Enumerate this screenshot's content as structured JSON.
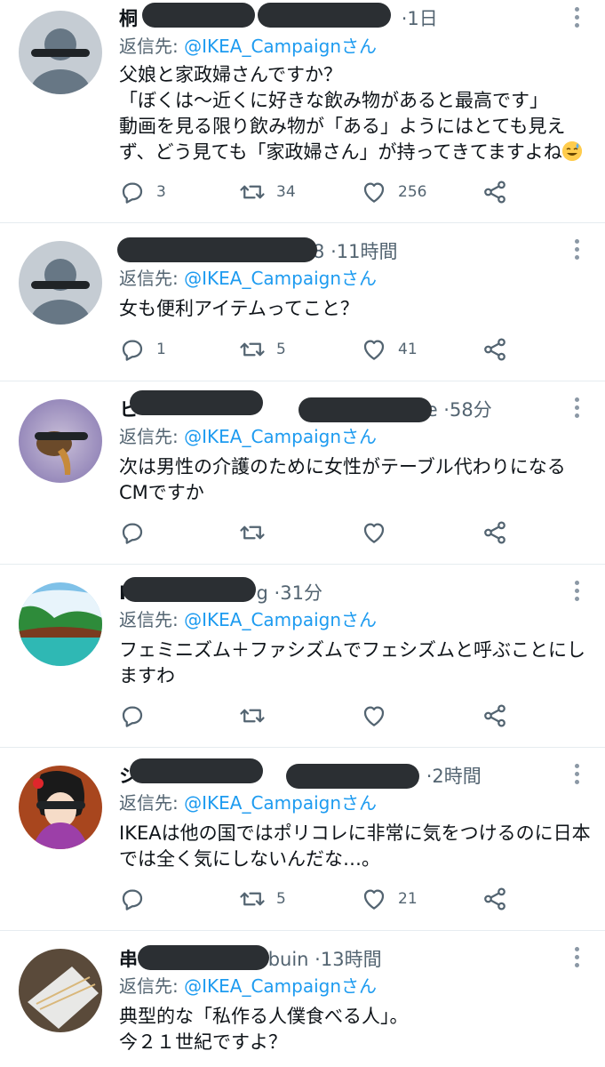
{
  "tweets": [
    {
      "name_visible": "桐",
      "handle_visible": "",
      "time": "1日",
      "reply_label": "返信先: ",
      "reply_mention": "@IKEA_Campaignさん",
      "lines": [
        "父娘と家政婦さんですか？",
        "「ぼくは〜近くに好きな飲み物があると最高です」",
        "動画を見る限り飲み物が「ある」ようにはとても見え",
        "ず、どう見ても「家政婦さん」が持ってきてますよね"
      ],
      "replies": "3",
      "retweets": "34",
      "likes": "256"
    },
    {
      "name_visible": "",
      "handle_visible": "8",
      "time": "11時間",
      "reply_label": "返信先: ",
      "reply_mention": "@IKEA_Campaignさん",
      "lines": [
        "女も便利アイテムってこと？"
      ],
      "replies": "1",
      "retweets": "5",
      "likes": "41"
    },
    {
      "name_visible": "ヒ",
      "handle_visible": "e",
      "time": "58分",
      "reply_label": "返信先: ",
      "reply_mention": "@IKEA_Campaignさん",
      "lines": [
        "次は男性の介護のために女性がテーブル代わりになる",
        "CMですか"
      ],
      "replies": "",
      "retweets": "",
      "likes": ""
    },
    {
      "name_visible": "I",
      "handle_visible": "g",
      "time": "31分",
      "reply_label": "返信先: ",
      "reply_mention": "@IKEA_Campaignさん",
      "lines": [
        "フェミニズム＋ファシズムでフェシズムと呼ぶことにし",
        "ますわ"
      ],
      "replies": "",
      "retweets": "",
      "likes": ""
    },
    {
      "name_visible": "シ",
      "handle_visible": "",
      "time": "2時間",
      "reply_label": "返信先: ",
      "reply_mention": "@IKEA_Campaignさん",
      "lines": [
        "IKEAは他の国ではポリコレに非常に気をつけるのに日本",
        "では全く気にしないんだな…。"
      ],
      "replies": "",
      "retweets": "5",
      "likes": "21"
    },
    {
      "name_visible": "串",
      "handle_visible": "buin",
      "time": "13時間",
      "reply_label": "返信先: ",
      "reply_mention": "@IKEA_Campaignさん",
      "lines": [
        "典型的な「私作る人僕食べる人」。",
        "今２１世紀ですよ？"
      ],
      "replies": "",
      "retweets": "",
      "likes": ""
    }
  ],
  "icons": {
    "reply": "reply-icon",
    "retweet": "retweet-icon",
    "like": "heart-icon",
    "share": "share-icon",
    "more": "more-vertical-icon",
    "emoji": "sweat-smile-emoji"
  },
  "colors": {
    "text": "#0f1419",
    "secondary": "#536471",
    "mention": "#1d9bf0",
    "divider": "#e6ecf0"
  }
}
